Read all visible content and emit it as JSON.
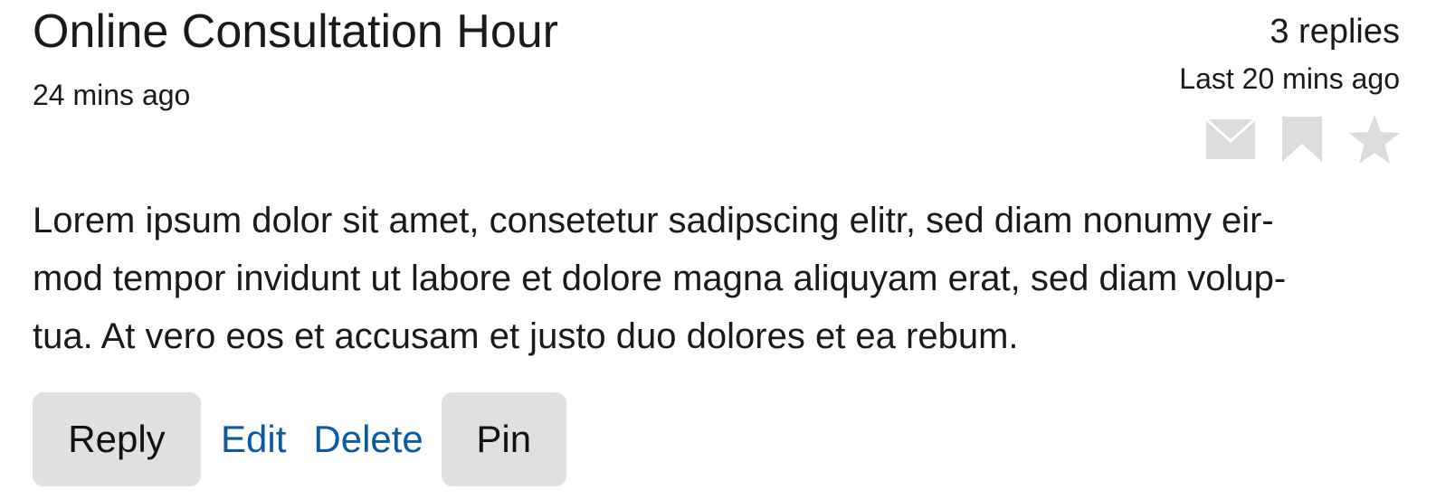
{
  "post": {
    "title": "Online Consultation Hour",
    "time_ago": "24 mins ago",
    "reply_count": "3 replies",
    "last_activity": "Last 20 mins ago",
    "body_lines": [
      "Lorem ipsum dolor sit amet, consetetur sadipscing elitr, sed diam nonumy eir-",
      "mod tempor invidunt ut labore et dolore magna aliquyam erat, sed diam volup-",
      "tua. At vero eos et accusam et justo duo dolores et ea rebum."
    ],
    "icons": [
      "envelope-icon",
      "bookmark-icon",
      "star-icon"
    ]
  },
  "actions": {
    "reply_label": "Reply",
    "edit_label": "Edit",
    "delete_label": "Delete",
    "pin_label": "Pin"
  },
  "colors": {
    "text": "#1a1a1a",
    "link": "#0a5aa8",
    "button_bg": "#e0e0e0",
    "icon": "#dcdcdc"
  }
}
